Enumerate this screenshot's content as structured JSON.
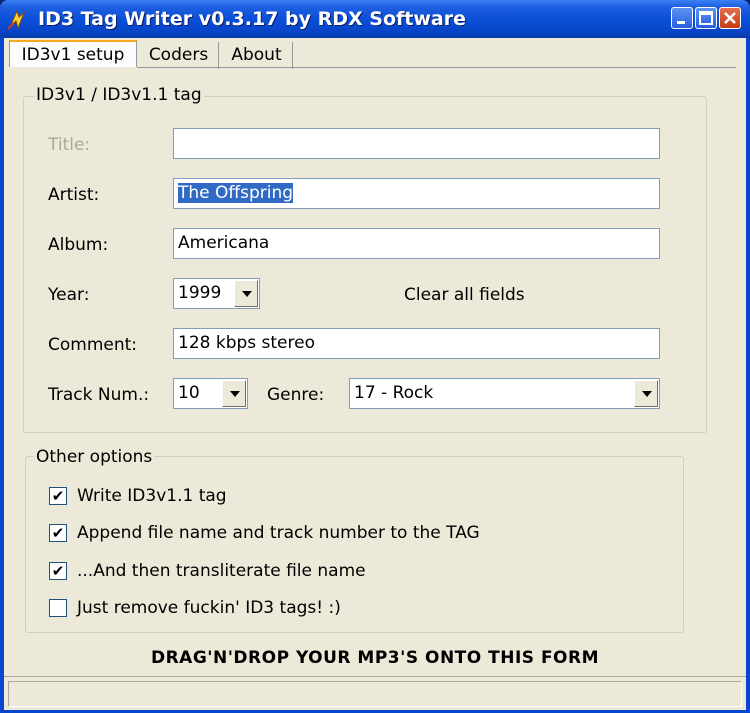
{
  "window": {
    "title": "ID3 Tag Writer v0.3.17 by RDX Software"
  },
  "tabs": [
    {
      "label": "ID3v1 setup",
      "active": true
    },
    {
      "label": "Coders",
      "active": false
    },
    {
      "label": "About",
      "active": false
    }
  ],
  "tag_group": {
    "legend": "ID3v1 / ID3v1.1 tag",
    "title_label": "Title:",
    "title_value": "",
    "artist_label": "Artist:",
    "artist_value": "The Offspring",
    "album_label": "Album:",
    "album_value": "Americana",
    "year_label": "Year:",
    "year_value": "1999",
    "clear_label": "Clear all fields",
    "comment_label": "Comment:",
    "comment_value": "128 kbps stereo",
    "track_label": "Track Num.:",
    "track_value": "10",
    "genre_label": "Genre:",
    "genre_value": "17 - Rock"
  },
  "options_group": {
    "legend": "Other options",
    "options": [
      {
        "label": "Write ID3v1.1 tag",
        "checked": true
      },
      {
        "label": "Append file name and track number to the TAG",
        "checked": true
      },
      {
        "label": "...And then transliterate file name",
        "checked": true
      },
      {
        "label": "Just remove fuckin' ID3 tags! :)",
        "checked": false
      }
    ]
  },
  "dragdrop_text": "DRAG'N'DROP YOUR MP3'S ONTO THIS FORM",
  "status_text": "",
  "check_glyph": "✔",
  "colors": {
    "titlebar": "#0a4fd8",
    "tab_accent": "#f9a920",
    "selection": "#316ac5"
  }
}
